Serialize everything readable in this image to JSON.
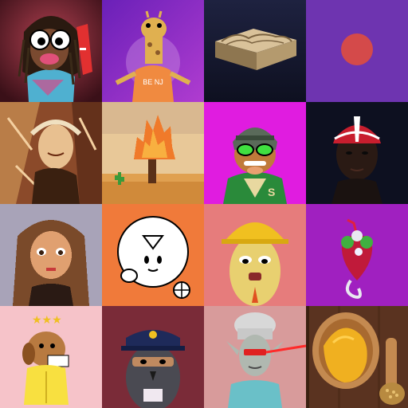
{
  "tiles": [
    {
      "subject": "rasta-googly-eye-character",
      "bg": "#8a2a40"
    },
    {
      "subject": "giraffe-in-orange-shirt",
      "bg": "#7a2fb0",
      "shirt_text": "BE NJ"
    },
    {
      "subject": "3d-wooden-terrain-box",
      "bg": "#16192e"
    },
    {
      "subject": "red-dot-on-purple",
      "bg": "#6e34b0"
    },
    {
      "subject": "abstract-painted-portrait",
      "bg": "#8b4a2a"
    },
    {
      "subject": "pixel-fire-tree-desert",
      "bg": "#d9a05a"
    },
    {
      "subject": "dog-in-helmet-varsity-jacket",
      "bg": "#e01ce0",
      "jacket_letter": "S"
    },
    {
      "subject": "3d-woman-red-cap",
      "bg": "#0d1020"
    },
    {
      "subject": "pixel-woman-curly-hair",
      "bg": "#a8a3b8"
    },
    {
      "subject": "cartoon-arrow-blob-and-ball",
      "bg": "#f07a3a"
    },
    {
      "subject": "potato-with-hard-hat",
      "bg": "#e67c7c"
    },
    {
      "subject": "flower-skull-heart",
      "bg": "#a020c0"
    },
    {
      "subject": "puppy-in-yellow-raincoat",
      "bg": "#f6c3c9"
    },
    {
      "subject": "police-bird-character",
      "bg": "#7a2b38"
    },
    {
      "subject": "elf-chef-with-laser-eyes",
      "bg": "#d89b9b"
    },
    {
      "subject": "mustard-in-wooden-spoon",
      "bg": "#5a3320"
    }
  ]
}
